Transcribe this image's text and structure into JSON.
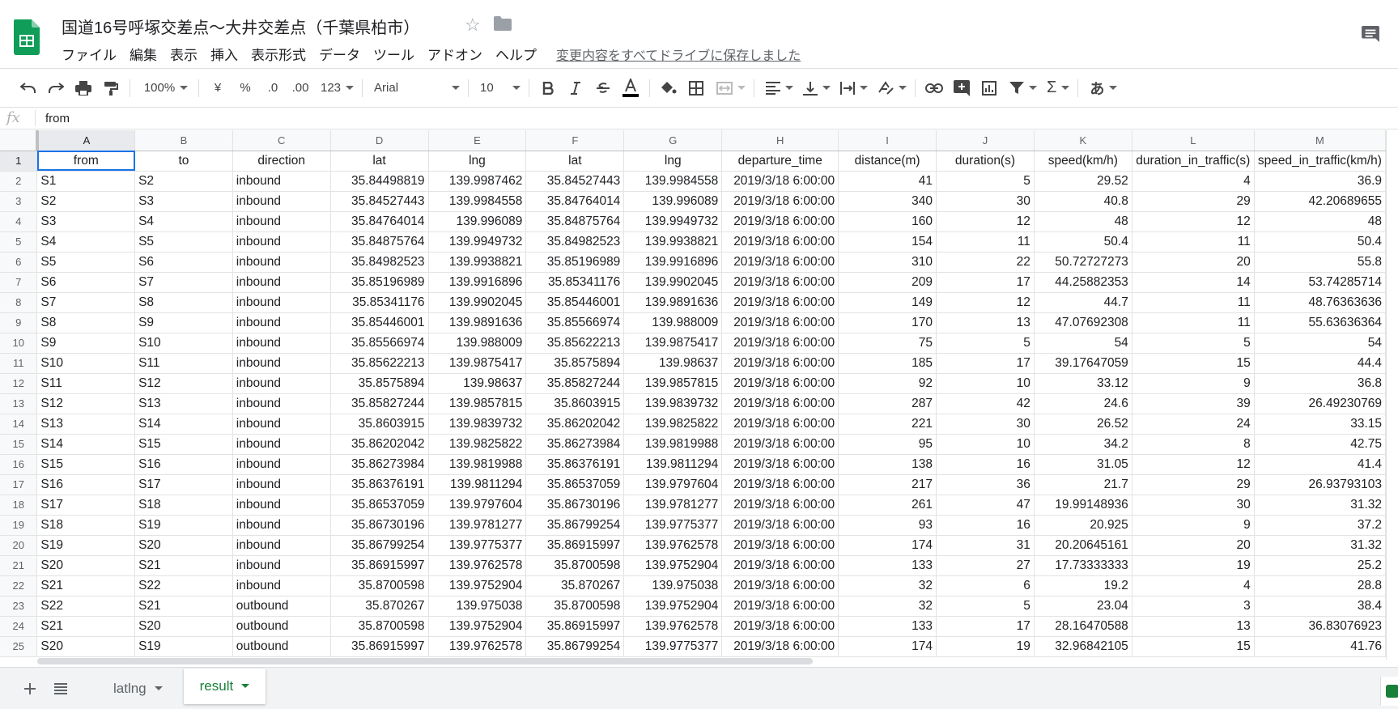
{
  "document": {
    "title": "国道16号呼塚交差点〜大井交差点（千葉県柏市）",
    "save_status": "変更内容をすべてドライブに保存しました"
  },
  "menu": [
    "ファイル",
    "編集",
    "表示",
    "挿入",
    "表示形式",
    "データ",
    "ツール",
    "アドオン",
    "ヘルプ"
  ],
  "toolbar": {
    "zoom": "100%",
    "currency": "¥",
    "percent": "%",
    "decrease_decimal": ".0",
    "increase_decimal": ".00",
    "more_formats": "123",
    "font": "Arial",
    "font_size": "10",
    "input_tool": "あ"
  },
  "formula_bar": {
    "fx": "fx",
    "value": "from"
  },
  "columns": [
    "A",
    "B",
    "C",
    "D",
    "E",
    "F",
    "G",
    "H",
    "I",
    "J",
    "K",
    "L",
    "M"
  ],
  "rows": [
    [
      "from",
      "to",
      "direction",
      "lat",
      "lng",
      "lat",
      "lng",
      "departure_time",
      "distance(m)",
      "duration(s)",
      "speed(km/h)",
      "duration_in_traffic(s)",
      "speed_in_traffic(km/h)"
    ],
    [
      "S1",
      "S2",
      "inbound",
      "35.84498819",
      "139.9987462",
      "35.84527443",
      "139.9984558",
      "2019/3/18 6:00:00",
      "41",
      "5",
      "29.52",
      "4",
      "36.9"
    ],
    [
      "S2",
      "S3",
      "inbound",
      "35.84527443",
      "139.9984558",
      "35.84764014",
      "139.996089",
      "2019/3/18 6:00:00",
      "340",
      "30",
      "40.8",
      "29",
      "42.20689655"
    ],
    [
      "S3",
      "S4",
      "inbound",
      "35.84764014",
      "139.996089",
      "35.84875764",
      "139.9949732",
      "2019/3/18 6:00:00",
      "160",
      "12",
      "48",
      "12",
      "48"
    ],
    [
      "S4",
      "S5",
      "inbound",
      "35.84875764",
      "139.9949732",
      "35.84982523",
      "139.9938821",
      "2019/3/18 6:00:00",
      "154",
      "11",
      "50.4",
      "11",
      "50.4"
    ],
    [
      "S5",
      "S6",
      "inbound",
      "35.84982523",
      "139.9938821",
      "35.85196989",
      "139.9916896",
      "2019/3/18 6:00:00",
      "310",
      "22",
      "50.72727273",
      "20",
      "55.8"
    ],
    [
      "S6",
      "S7",
      "inbound",
      "35.85196989",
      "139.9916896",
      "35.85341176",
      "139.9902045",
      "2019/3/18 6:00:00",
      "209",
      "17",
      "44.25882353",
      "14",
      "53.74285714"
    ],
    [
      "S7",
      "S8",
      "inbound",
      "35.85341176",
      "139.9902045",
      "35.85446001",
      "139.9891636",
      "2019/3/18 6:00:00",
      "149",
      "12",
      "44.7",
      "11",
      "48.76363636"
    ],
    [
      "S8",
      "S9",
      "inbound",
      "35.85446001",
      "139.9891636",
      "35.85566974",
      "139.988009",
      "2019/3/18 6:00:00",
      "170",
      "13",
      "47.07692308",
      "11",
      "55.63636364"
    ],
    [
      "S9",
      "S10",
      "inbound",
      "35.85566974",
      "139.988009",
      "35.85622213",
      "139.9875417",
      "2019/3/18 6:00:00",
      "75",
      "5",
      "54",
      "5",
      "54"
    ],
    [
      "S10",
      "S11",
      "inbound",
      "35.85622213",
      "139.9875417",
      "35.8575894",
      "139.98637",
      "2019/3/18 6:00:00",
      "185",
      "17",
      "39.17647059",
      "15",
      "44.4"
    ],
    [
      "S11",
      "S12",
      "inbound",
      "35.8575894",
      "139.98637",
      "35.85827244",
      "139.9857815",
      "2019/3/18 6:00:00",
      "92",
      "10",
      "33.12",
      "9",
      "36.8"
    ],
    [
      "S12",
      "S13",
      "inbound",
      "35.85827244",
      "139.9857815",
      "35.8603915",
      "139.9839732",
      "2019/3/18 6:00:00",
      "287",
      "42",
      "24.6",
      "39",
      "26.49230769"
    ],
    [
      "S13",
      "S14",
      "inbound",
      "35.8603915",
      "139.9839732",
      "35.86202042",
      "139.9825822",
      "2019/3/18 6:00:00",
      "221",
      "30",
      "26.52",
      "24",
      "33.15"
    ],
    [
      "S14",
      "S15",
      "inbound",
      "35.86202042",
      "139.9825822",
      "35.86273984",
      "139.9819988",
      "2019/3/18 6:00:00",
      "95",
      "10",
      "34.2",
      "8",
      "42.75"
    ],
    [
      "S15",
      "S16",
      "inbound",
      "35.86273984",
      "139.9819988",
      "35.86376191",
      "139.9811294",
      "2019/3/18 6:00:00",
      "138",
      "16",
      "31.05",
      "12",
      "41.4"
    ],
    [
      "S16",
      "S17",
      "inbound",
      "35.86376191",
      "139.9811294",
      "35.86537059",
      "139.9797604",
      "2019/3/18 6:00:00",
      "217",
      "36",
      "21.7",
      "29",
      "26.93793103"
    ],
    [
      "S17",
      "S18",
      "inbound",
      "35.86537059",
      "139.9797604",
      "35.86730196",
      "139.9781277",
      "2019/3/18 6:00:00",
      "261",
      "47",
      "19.99148936",
      "30",
      "31.32"
    ],
    [
      "S18",
      "S19",
      "inbound",
      "35.86730196",
      "139.9781277",
      "35.86799254",
      "139.9775377",
      "2019/3/18 6:00:00",
      "93",
      "16",
      "20.925",
      "9",
      "37.2"
    ],
    [
      "S19",
      "S20",
      "inbound",
      "35.86799254",
      "139.9775377",
      "35.86915997",
      "139.9762578",
      "2019/3/18 6:00:00",
      "174",
      "31",
      "20.20645161",
      "20",
      "31.32"
    ],
    [
      "S20",
      "S21",
      "inbound",
      "35.86915997",
      "139.9762578",
      "35.8700598",
      "139.9752904",
      "2019/3/18 6:00:00",
      "133",
      "27",
      "17.73333333",
      "19",
      "25.2"
    ],
    [
      "S21",
      "S22",
      "inbound",
      "35.8700598",
      "139.9752904",
      "35.870267",
      "139.975038",
      "2019/3/18 6:00:00",
      "32",
      "6",
      "19.2",
      "4",
      "28.8"
    ],
    [
      "S22",
      "S21",
      "outbound",
      "35.870267",
      "139.975038",
      "35.8700598",
      "139.9752904",
      "2019/3/18 6:00:00",
      "32",
      "5",
      "23.04",
      "3",
      "38.4"
    ],
    [
      "S21",
      "S20",
      "outbound",
      "35.8700598",
      "139.9752904",
      "35.86915997",
      "139.9762578",
      "2019/3/18 6:00:00",
      "133",
      "17",
      "28.16470588",
      "13",
      "36.83076923"
    ],
    [
      "S20",
      "S19",
      "outbound",
      "35.86915997",
      "139.9762578",
      "35.86799254",
      "139.9775377",
      "2019/3/18 6:00:00",
      "174",
      "19",
      "32.96842105",
      "15",
      "41.76"
    ]
  ],
  "sheets": [
    {
      "label": "latlng",
      "active": false
    },
    {
      "label": "result",
      "active": true
    }
  ],
  "colors": {
    "accent": "#1a73e8",
    "sheets_green": "#188038",
    "header_bg": "#f8f9fa"
  },
  "icons": {
    "undo": "undo-icon",
    "redo": "redo-icon",
    "print": "print-icon",
    "paint_format": "paint-format-icon",
    "bold": "bold-icon",
    "italic": "italic-icon",
    "strikethrough": "strikethrough-icon",
    "text_color": "text-color-icon",
    "fill_color": "fill-color-icon",
    "borders": "borders-icon",
    "merge": "merge-icon",
    "align": "align-icon",
    "valign": "vertical-align-icon",
    "wrap": "text-wrap-icon",
    "rotate": "text-rotate-icon",
    "link": "link-icon",
    "comment": "insert-comment-icon",
    "chart": "chart-icon",
    "filter": "filter-icon",
    "functions": "functions-icon"
  }
}
